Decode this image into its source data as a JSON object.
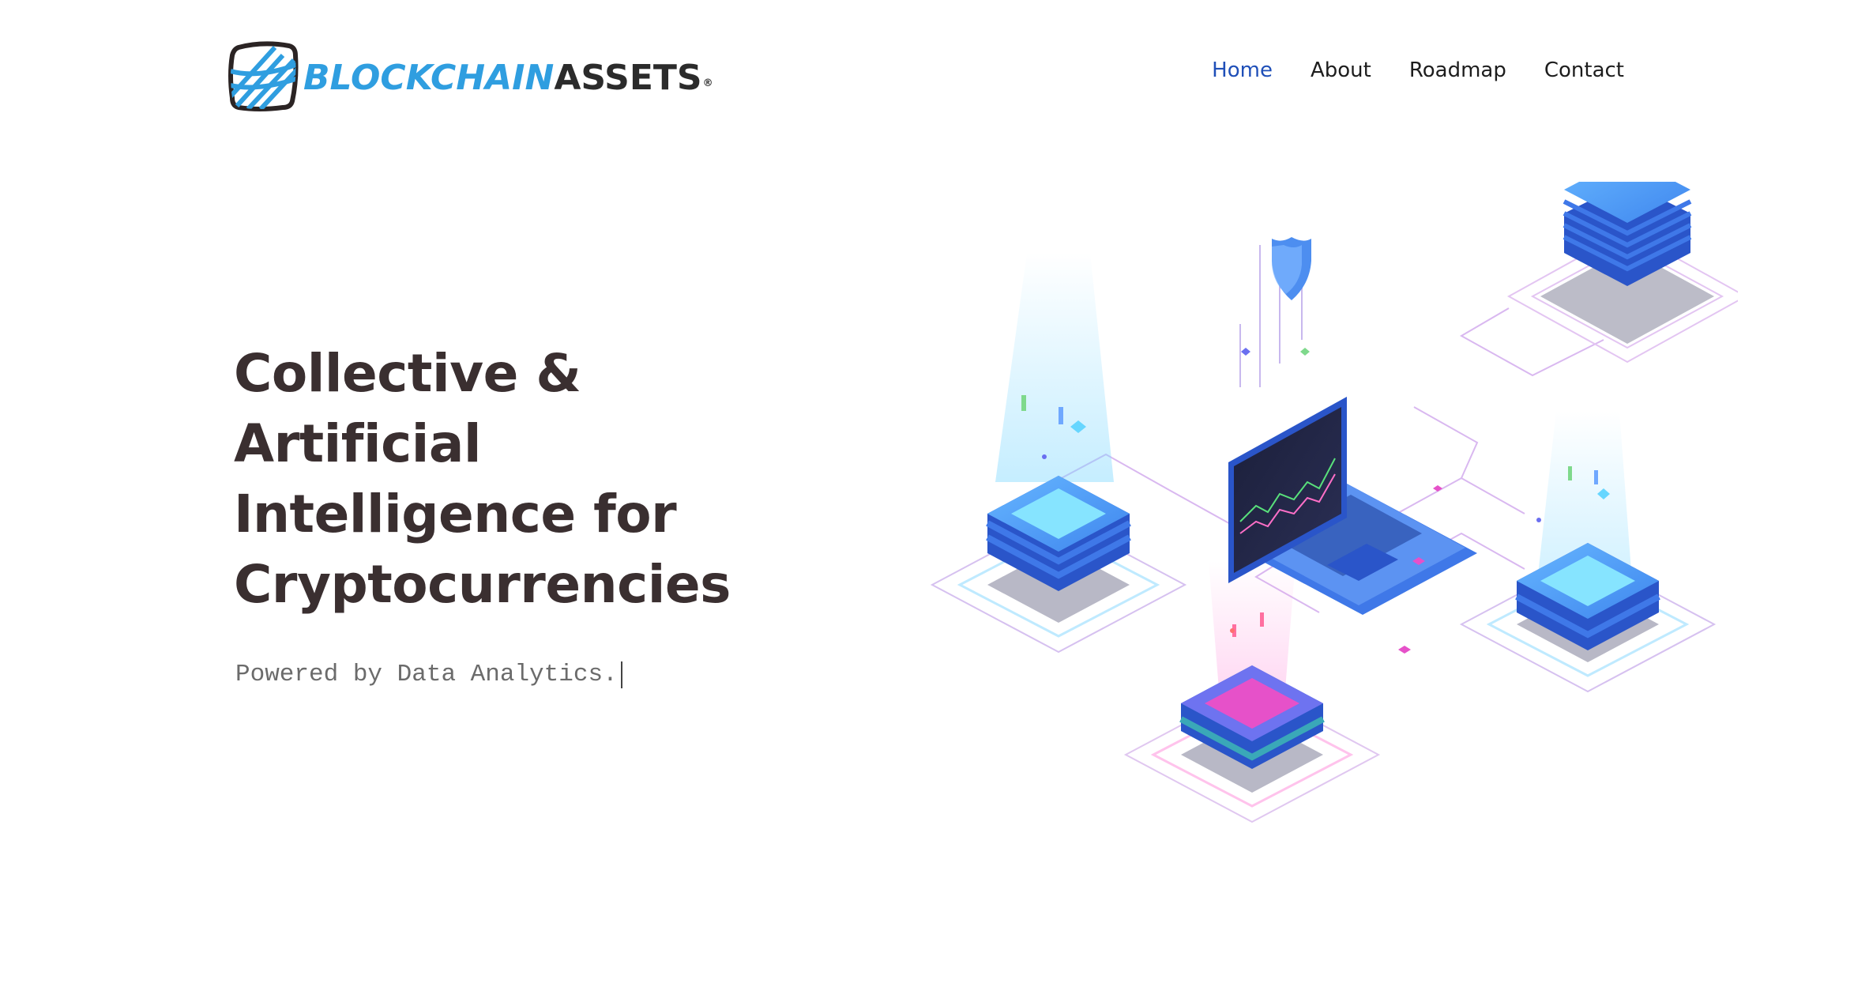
{
  "brand": {
    "name_part1": "BLOCKCHAIN",
    "name_part2": "ASSETS",
    "registered_mark": "®",
    "colors": {
      "blue": "#2f9ee0",
      "dark": "#2b2b2b"
    }
  },
  "nav": {
    "items": [
      {
        "label": "Home",
        "active": true
      },
      {
        "label": "About",
        "active": false
      },
      {
        "label": "Roadmap",
        "active": false
      },
      {
        "label": "Contact",
        "active": false
      }
    ],
    "active_color": "#1f4fb8"
  },
  "hero": {
    "title_lines": [
      "Collective &",
      "Artificial",
      "Intelligence for",
      "Cryptocurrencies"
    ],
    "subtitle": "Powered by Data Analytics."
  },
  "illustration": {
    "icons": [
      "server-stack-icon",
      "laptop-chart-icon",
      "shield-icon",
      "data-block-icon"
    ]
  }
}
